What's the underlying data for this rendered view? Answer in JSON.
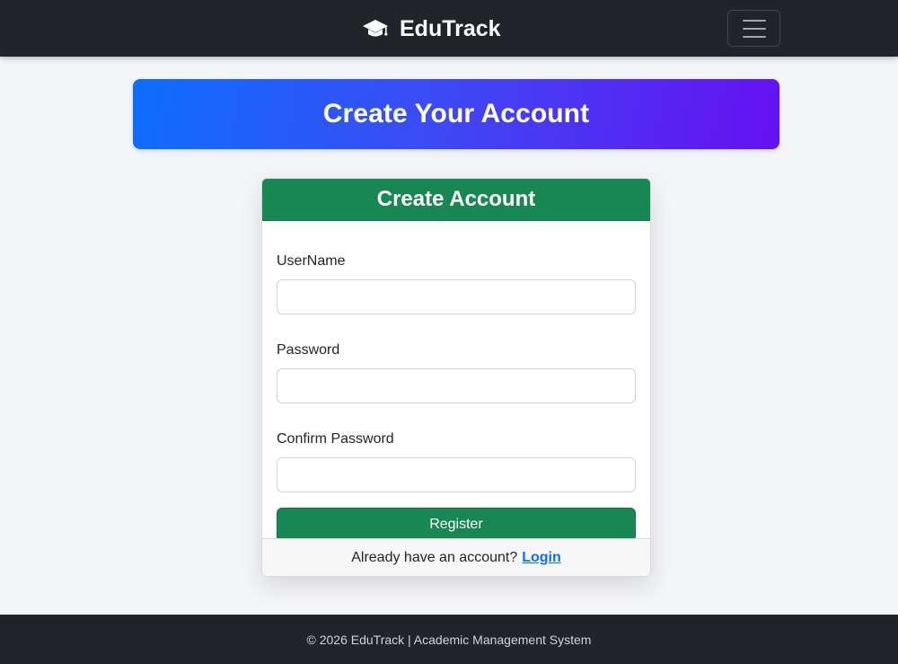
{
  "navbar": {
    "brand": "EduTrack",
    "brand_icon": "graduation-cap-icon",
    "toggler_icon": "hamburger-menu-icon"
  },
  "banner": {
    "title": "Create Your Account"
  },
  "card": {
    "title": "Create Account",
    "fields": {
      "username": {
        "label": "UserName",
        "value": ""
      },
      "password": {
        "label": "Password",
        "value": ""
      },
      "confirm_password": {
        "label": "Confirm Password",
        "value": ""
      }
    },
    "submit_label": "Register",
    "footer": {
      "text": "Already have an account?",
      "link": "Login"
    }
  },
  "footer": {
    "text": "© 2026 EduTrack | Academic Management System"
  },
  "colors": {
    "navbar_bg": "#212529",
    "banner_gradient_start": "#0d6efd",
    "banner_gradient_end": "#6610f2",
    "success": "#198754",
    "link": "#0d6efd",
    "page_bg": "#f4f5f8"
  }
}
